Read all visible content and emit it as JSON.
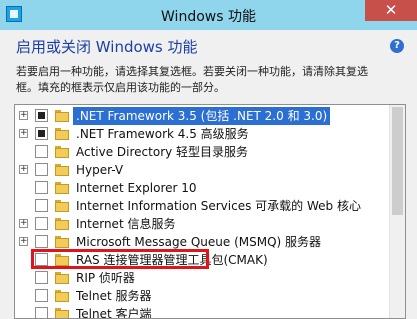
{
  "window": {
    "title": "Windows 功能",
    "close_glyph": "✕"
  },
  "header": {
    "heading": "启用或关闭 Windows 功能",
    "help_glyph": "?",
    "description": [
      "若要启用一种功能，请选择其复选框。若要关闭一种功能，请清除其复选",
      "框。填充的框表示仅启用该功能的一部分。"
    ]
  },
  "features": [
    {
      "label": ".NET Framework 3.5 (包括 .NET 2.0 和 3.0)",
      "expandable": true,
      "state": "partial",
      "selected": true
    },
    {
      "label": ".NET Framework 4.5 高级服务",
      "expandable": true,
      "state": "partial",
      "selected": false
    },
    {
      "label": "Active Directory 轻型目录服务",
      "expandable": false,
      "state": "unchecked",
      "selected": false
    },
    {
      "label": "Hyper-V",
      "expandable": true,
      "state": "unchecked",
      "selected": false
    },
    {
      "label": "Internet Explorer 10",
      "expandable": false,
      "state": "unchecked",
      "selected": false,
      "highlighted": true
    },
    {
      "label": "Internet Information Services 可承载的 Web 核心",
      "expandable": false,
      "state": "unchecked",
      "selected": false
    },
    {
      "label": "Internet 信息服务",
      "expandable": true,
      "state": "unchecked",
      "selected": false
    },
    {
      "label": "Microsoft Message Queue (MSMQ) 服务器",
      "expandable": true,
      "state": "unchecked",
      "selected": false
    },
    {
      "label": "RAS 连接管理器管理工具包(CMAK)",
      "expandable": false,
      "state": "unchecked",
      "selected": false
    },
    {
      "label": "RIP 侦听器",
      "expandable": false,
      "state": "unchecked",
      "selected": false
    },
    {
      "label": "Telnet 服务器",
      "expandable": false,
      "state": "unchecked",
      "selected": false
    },
    {
      "label": "Telnet 客户端",
      "expandable": false,
      "state": "unchecked",
      "selected": false
    }
  ],
  "colors": {
    "titlebar": "#8fd5ec",
    "heading": "#1b3fa6",
    "selection": "#2c6fd2",
    "highlight_box": "#e0141b",
    "folder": "#f2cc5a"
  }
}
